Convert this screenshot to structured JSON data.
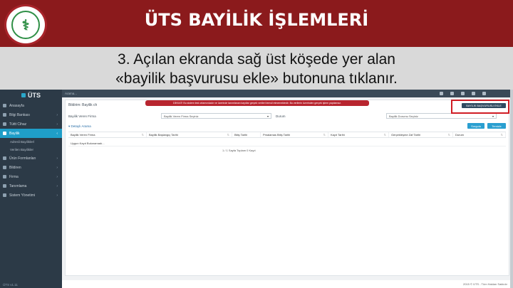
{
  "header": {
    "title": "ÜTS BAYİLİK İŞLEMLERİ",
    "logo_text": "TÜRK ECZACILARI BİRLİĞİ"
  },
  "instruction": {
    "line1": "3. Açılan ekranda sağ üst köşede yer alan",
    "line2": "«bayilik başvurusu ekle» butonuna tıklanır."
  },
  "app": {
    "logo": "ÜTS",
    "topbar_search": "Arama...",
    "sidebar": {
      "items": [
        {
          "label": "Anasayfa",
          "icon": "home-icon"
        },
        {
          "label": "Bilgi Bankası",
          "icon": "book-icon"
        },
        {
          "label": "Tüttt Cihaz",
          "icon": "device-icon"
        },
        {
          "label": "Bayilik",
          "icon": "store-icon",
          "active": true
        }
      ],
      "subitems": [
        "Adresli Bayiliklerl",
        "Verilen Bayilikler"
      ],
      "more_items": [
        {
          "label": "Ürün Formlanları",
          "icon": "list-icon"
        },
        {
          "label": "Bildiren",
          "icon": "bell-icon"
        },
        {
          "label": "Firma",
          "icon": "building-icon"
        },
        {
          "label": "Tanımlama",
          "icon": "tag-icon"
        },
        {
          "label": "Sistem Yönetimi",
          "icon": "settings-icon"
        }
      ],
      "version": "ÜTS v1.11"
    },
    "breadcrumb": "Bildirim: Bayilik ch",
    "warning": "DİKKAT! Bu sistem test ortamındadır ve üzerinde tanımlanan kayıtlar gerçek verileri temsil etmemektedir. Bu verilerin üzerinden gerçek işlem yapılamaz.",
    "add_button": "BAYİLİK BAŞVURUSU EKLE",
    "filters": {
      "firm_label": "Bayilik Veren Firma",
      "firm_value": "Bayilik Veren Firma Seçiniz",
      "status_label": "Durum",
      "status_value": "Bayilik Durumu Seçiniz"
    },
    "collapse_label": "Detaylı Arama",
    "search_button": "Sorgula",
    "clear_button": "Temizle",
    "columns": [
      "Bayilik Veren Firma",
      "Bayilik Başlangıç Tarihi",
      "Bitiş Tarihi",
      "Pmalamas Bitiş Tarihi",
      "Kayıt Tarihi",
      "Gerçekleşme Zaf Tarihi",
      "Durum"
    ],
    "empty_row": "Uygun Kayıt Bulunamadı...",
    "pager": "1 / 1  Sayfa  Toplam 0 Kayıt",
    "footer": "2015 © ÜTS - Tüm Hakları Saklıdır"
  },
  "colors": {
    "header_bg": "#8b1a1c",
    "instruction_bg": "#d9d9d9",
    "sidebar_bg": "#2c3a47",
    "accent": "#1f9ec8",
    "highlight": "#d01c24"
  }
}
